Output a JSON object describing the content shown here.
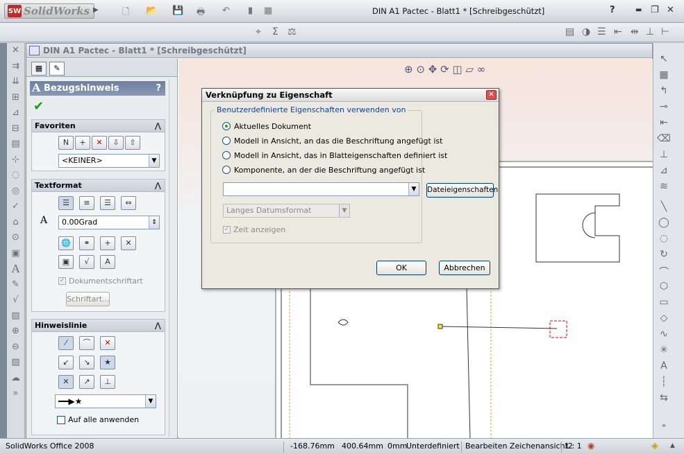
{
  "app": {
    "logo_text": "SolidWorks",
    "logo_badge": "SW"
  },
  "window_title": "DIN A1 Pactec - Blatt1 * [Schreibgeschützt]",
  "window_buttons": {
    "help": "?",
    "minimize": "▬",
    "restore": "❐",
    "close": "✕"
  },
  "document": {
    "title": "DIN A1 Pactec - Blatt1 * [Schreibgeschützt]"
  },
  "property_manager": {
    "title": "Bezugshinweis",
    "title_glyph": "A",
    "help": "?",
    "ok_icon": "check-icon",
    "favoriten": {
      "label": "Favoriten",
      "dropdown_value": "<KEINER>"
    },
    "textformat": {
      "label": "Textformat",
      "angle_value": "0.00Grad",
      "checkbox_label": "Dokumentschriftart",
      "button_label": "Schriftart..."
    },
    "hinweislinie": {
      "label": "Hinweislinie",
      "apply_all_label": "Auf alle anwenden"
    }
  },
  "dialog": {
    "title": "Verknüpfung zu Eigenschaft",
    "group_label": "Benutzerdefinierte Eigenschaften verwenden von",
    "options": [
      {
        "label": "Aktuelles Dokument",
        "selected": true
      },
      {
        "label": "Modell in Ansicht, an das die Beschriftung angefügt ist",
        "selected": false
      },
      {
        "label": "Modell in Ansicht, das in Blatteigenschaften definiert ist",
        "selected": false
      },
      {
        "label": "Komponente, an der die Beschriftung angefügt ist",
        "selected": false
      }
    ],
    "property_value": "",
    "file_properties_button": "Dateieigenschaften",
    "date_format": "Langes Datumsformat",
    "show_time_label": "Zeit anzeigen",
    "ok": "OK",
    "cancel": "Abbrechen"
  },
  "status": {
    "product": "SolidWorks Office 2008",
    "x": "-168.76mm",
    "y": "400.64mm",
    "z": "0mm",
    "state": "Unterdefiniert",
    "mode": "Bearbeiten Zeichenansicht2",
    "scale": "1 : 1"
  }
}
